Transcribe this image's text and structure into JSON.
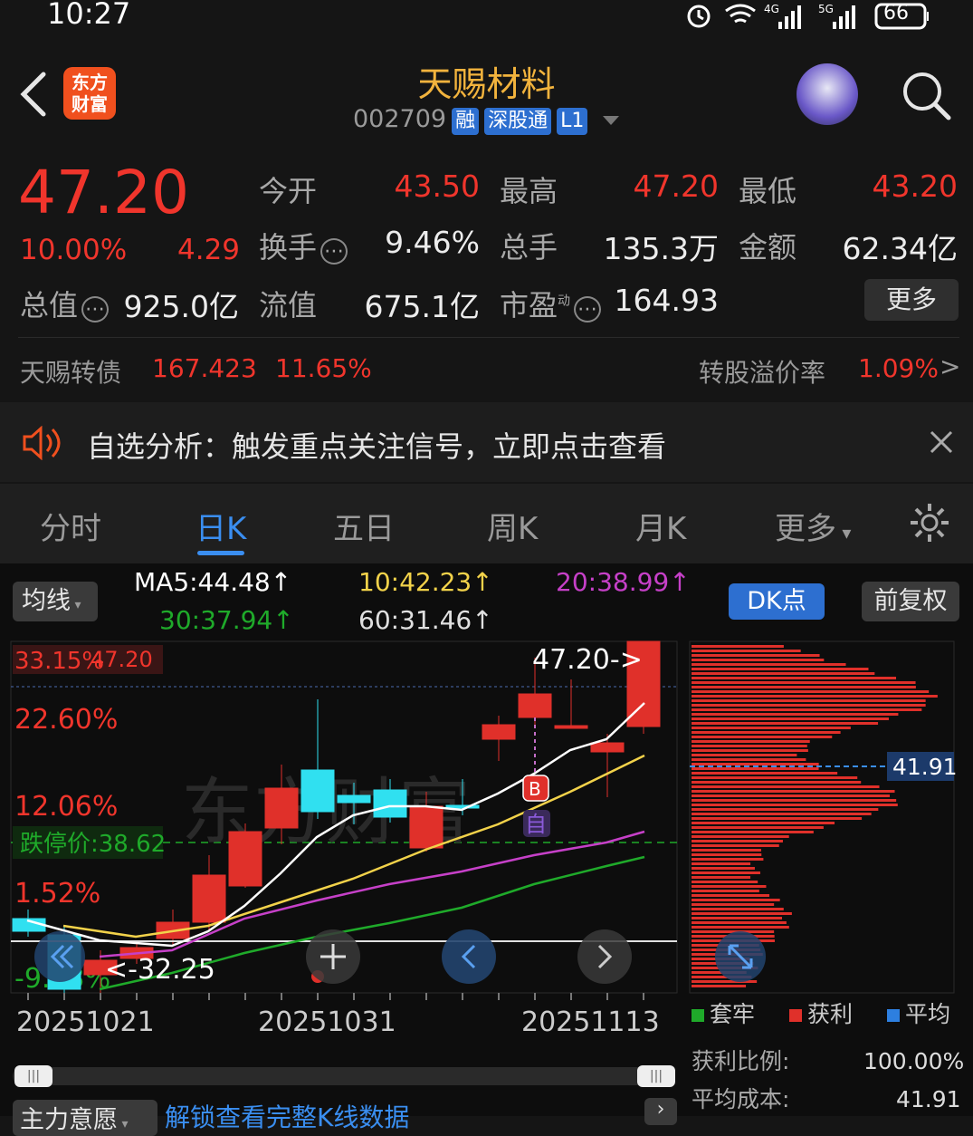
{
  "status_bar": {
    "time": "10:27",
    "battery": "66",
    "net1": "4G",
    "net2": "5G"
  },
  "header": {
    "app_logo_line1": "东方",
    "app_logo_line2": "财富",
    "stock_name": "天赐材料",
    "stock_code": "002709",
    "badges": [
      "融",
      "深股通",
      "L1"
    ]
  },
  "quote": {
    "price": "47.20",
    "change_pct": "10.00%",
    "change": "4.29",
    "open_label": "今开",
    "open": "43.50",
    "high_label": "最高",
    "high": "47.20",
    "low_label": "最低",
    "low": "43.20",
    "turnover_label": "换手",
    "turnover": "9.46%",
    "volume_label": "总手",
    "volume": "135.3万",
    "amount_label": "金额",
    "amount": "62.34亿",
    "mktcap_label": "总值",
    "mktcap": "925.0亿",
    "float_label": "流值",
    "float": "675.1亿",
    "pe_label": "市盈",
    "pe_sup": "动",
    "pe": "164.93",
    "more_label": "更多",
    "bond_name": "天赐转债",
    "bond_price": "167.423",
    "bond_pct": "11.65%",
    "premium_label": "转股溢价率",
    "premium": "1.09%",
    "premium_arrow": ">"
  },
  "notice": {
    "text": "自选分析：触发重点关注信号，立即点击查看"
  },
  "tabs": [
    {
      "label": "分时"
    },
    {
      "label": "日K"
    },
    {
      "label": "五日"
    },
    {
      "label": "周K"
    },
    {
      "label": "月K"
    },
    {
      "label": "更多"
    }
  ],
  "chart": {
    "ma_button": "均线",
    "ma5": "MA5:44.48↑",
    "ma10": "10:42.23↑",
    "ma20": "20:38.99↑",
    "ma30": "30:37.94↑",
    "ma60": "60:31.46↑",
    "dk_button": "DK点",
    "fq_button": "前复权",
    "y_top_label": "33.15%",
    "y_top_overlay": "47.20",
    "y_labels": [
      "22.60%",
      "12.06%",
      "1.52%",
      "-9.03%"
    ],
    "limit_down": "跌停价:38.62",
    "high_marker": "47.20->",
    "low_marker": "<-32.25",
    "signal_b": "B",
    "signal_self": "自",
    "watermark": "东方财富",
    "dates": [
      "20251021",
      "20251031",
      "20251113"
    ],
    "chip_avg": "41.91",
    "legend": [
      "套牢",
      "获利",
      "平均"
    ],
    "profit_ratio_label": "获利比例:",
    "profit_ratio": "100.00%",
    "avg_cost_label": "平均成本:",
    "avg_cost": "41.91",
    "bottom_tab": "主力意愿",
    "bottom_link": "解锁查看完整K线数据"
  },
  "colors": {
    "up": "#f0352c",
    "down": "#30e0f0",
    "accent": "#2d7fe0",
    "ma5": "#ffffff",
    "ma10": "#f2d24a",
    "ma20": "#c640c8",
    "ma30": "#1faa2a",
    "ma60": "#e0e0e0"
  }
}
